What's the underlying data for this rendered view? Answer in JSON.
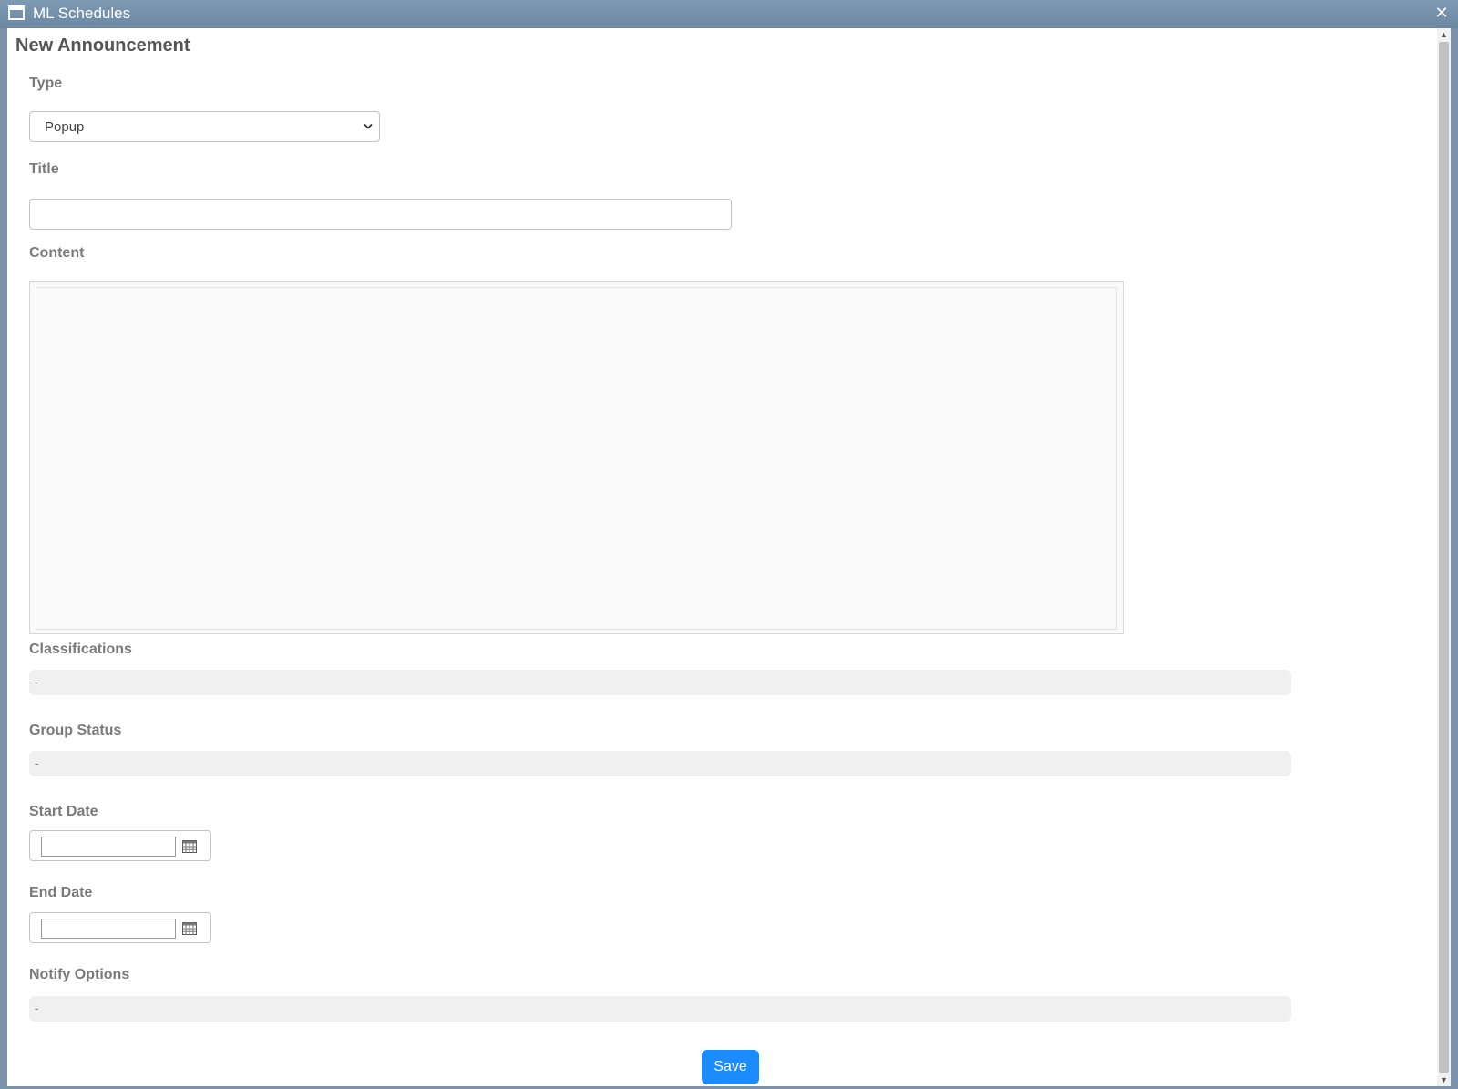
{
  "window": {
    "title": "ML Schedules",
    "close_symbol": "✕",
    "icons": {
      "window": "window-icon",
      "close": "close-icon"
    }
  },
  "form": {
    "heading": "New Announcement",
    "type": {
      "label": "Type",
      "selected": "Popup"
    },
    "title": {
      "label": "Title",
      "value": ""
    },
    "content": {
      "label": "Content",
      "value": ""
    },
    "classifications": {
      "label": "Classifications",
      "value": "-"
    },
    "group_status": {
      "label": "Group Status",
      "value": "-"
    },
    "start_date": {
      "label": "Start Date",
      "value": ""
    },
    "end_date": {
      "label": "End Date",
      "value": ""
    },
    "notify_options": {
      "label": "Notify Options",
      "value": "-"
    },
    "save_label": "Save"
  },
  "colors": {
    "accent": "#1a8cff",
    "titlebar": "#7a93ab",
    "label_text": "#7a7a7a"
  }
}
